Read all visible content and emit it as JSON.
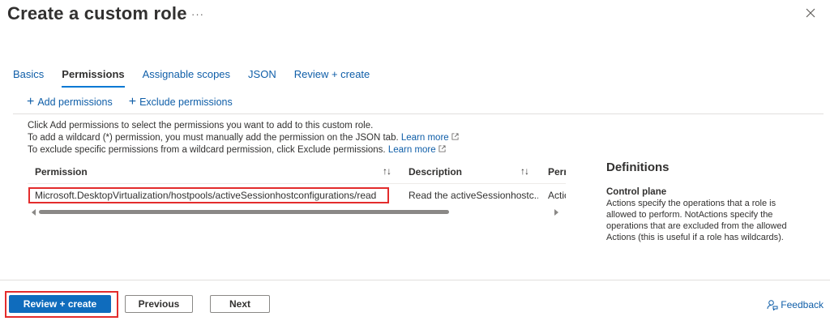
{
  "header": {
    "title": "Create a custom role",
    "more_label": "···",
    "close_icon": "close-icon"
  },
  "tabs": [
    {
      "label": "Basics",
      "active": false
    },
    {
      "label": "Permissions",
      "active": true
    },
    {
      "label": "Assignable scopes",
      "active": false
    },
    {
      "label": "JSON",
      "active": false
    },
    {
      "label": "Review + create",
      "active": false
    }
  ],
  "commands": {
    "add": "Add permissions",
    "exclude": "Exclude permissions"
  },
  "info": {
    "line1": "Click Add permissions to select the permissions you want to add to this custom role.",
    "line2": "To add a wildcard (*) permission, you must manually add the permission on the JSON tab.",
    "line3": "To exclude specific permissions from a wildcard permission, click Exclude permissions.",
    "learn_more": "Learn more"
  },
  "grid": {
    "columns": [
      "Permission",
      "Description",
      "Pern"
    ],
    "sort_glyph": "↑↓",
    "rows": [
      {
        "permission": "Microsoft.DesktopVirtualization/hostpools/activeSessionhostconfigurations/read",
        "description": "Read the activeSessionhostc...",
        "type": "Actic"
      }
    ]
  },
  "definitions": {
    "title": "Definitions",
    "heading": "Control plane",
    "body": "Actions specify the operations that a role is allowed to perform. NotActions specify the operations that are excluded from the allowed Actions (this is useful if a role has wildcards)."
  },
  "footer": {
    "review_create": "Review + create",
    "previous": "Previous",
    "next": "Next",
    "feedback": "Feedback"
  },
  "colors": {
    "accent": "#0f6cbd",
    "link": "#0f5ea8",
    "highlight": "#e32c2c"
  }
}
